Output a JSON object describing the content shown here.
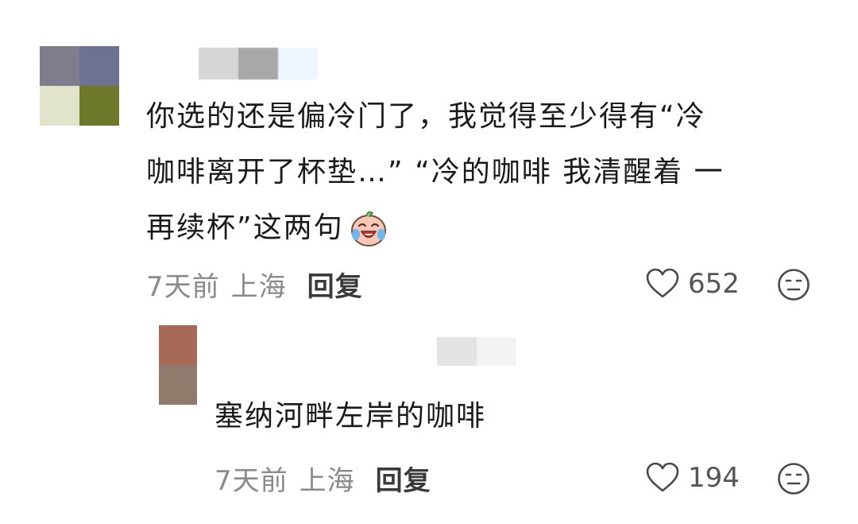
{
  "comments": [
    {
      "avatar_colors": [
        "#7f7d8d",
        "#6e7292",
        "#e1e4cb",
        "#6e782a"
      ],
      "username_blur_colors": [
        "#d6d6d6",
        "#a8a8a8",
        "#edf6ff"
      ],
      "text_lines": [
        "你选的还是偏冷门了，我觉得至少得有“冷",
        "咖啡离开了杯垫…”  “冷的咖啡 我清醒着 一",
        "再续杯”这两句"
      ],
      "emoji_icon": "crying-laughing-face-icon",
      "time": "7天前",
      "location": "上海",
      "reply_label": "回复",
      "like_count": "652",
      "like_icon": "heart-outline-icon",
      "dislike_icon": "meh-face-icon"
    },
    {
      "avatar_colors": [
        "#a86a58",
        "#8f7a6c"
      ],
      "username_blur_colors": [
        "#e3e3e3",
        "#f3f3f3"
      ],
      "text": "塞纳河畔左岸的咖啡",
      "time": "7天前",
      "location": "上海",
      "reply_label": "回复",
      "like_count": "194",
      "like_icon": "heart-outline-icon",
      "dislike_icon": "meh-face-icon"
    }
  ]
}
